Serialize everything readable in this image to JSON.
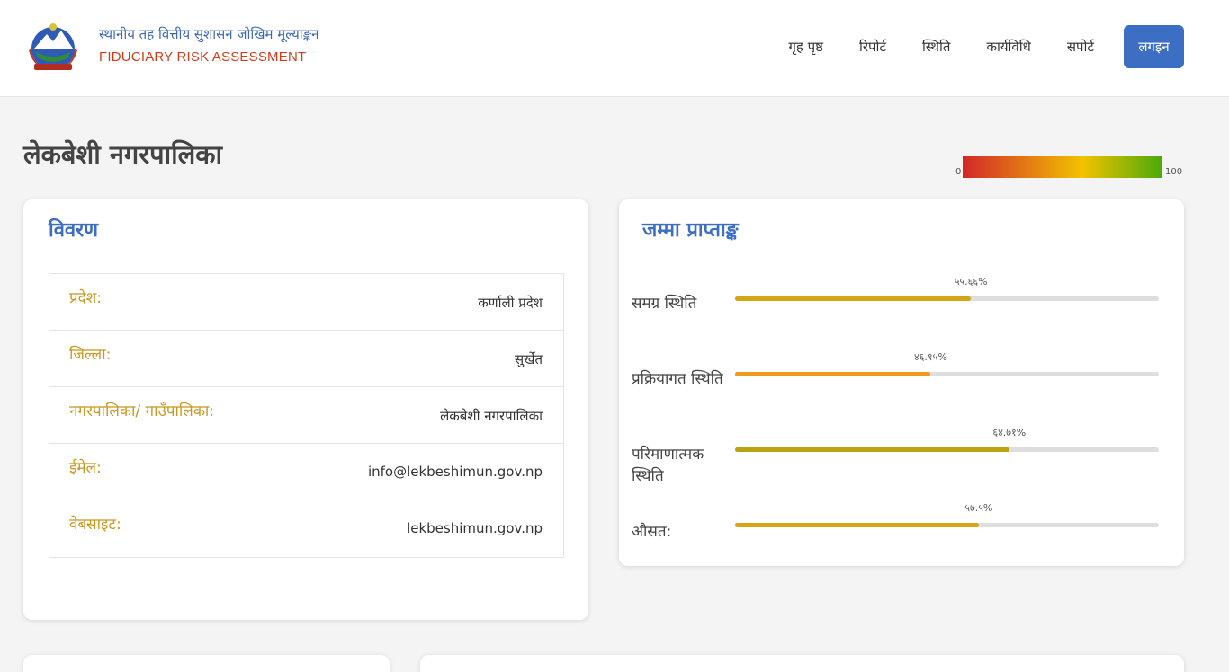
{
  "header": {
    "title_np": "स्थानीय तह वित्तीय सुशासन जोखिम मूल्याङ्कन",
    "title_en": "FIDUCIARY RISK ASSESSMENT",
    "nav": [
      {
        "label": "गृह पृष्ठ",
        "name": "nav-home"
      },
      {
        "label": "रिपोर्ट",
        "name": "nav-report"
      },
      {
        "label": "स्थिति",
        "name": "nav-status"
      },
      {
        "label": "कार्यविधि",
        "name": "nav-procedure"
      },
      {
        "label": "सपोर्ट",
        "name": "nav-support"
      }
    ],
    "login_label": "लगइन"
  },
  "page": {
    "title": "लेकबेशी नगरपालिका"
  },
  "legend": {
    "min": "0",
    "max": "100",
    "colors": [
      "#d32828",
      "#f2c200",
      "#4aaa0a"
    ]
  },
  "details": {
    "title": "विवरण",
    "rows": [
      {
        "label": "प्रदेश:",
        "value": "कर्णाली प्रदेश"
      },
      {
        "label": "जिल्ला:",
        "value": "सुर्खेत"
      },
      {
        "label": "नगरपालिका/ गाउँपालिका:",
        "value": "लेकबेशी नगरपालिका"
      },
      {
        "label": "ईमेल:",
        "value": "info@lekbeshimun.gov.np"
      },
      {
        "label": "वेबसाइट:",
        "value": "lekbeshimun.gov.np"
      }
    ]
  },
  "scores": {
    "title": "जम्मा प्राप्ताङ्क",
    "items": [
      {
        "label": "समग्र स्थिति",
        "pct_text": "५५.६६%",
        "value": 55.66,
        "color": "#d4a514"
      },
      {
        "label": "प्रक्रियागत स्थिति",
        "pct_text": "४६.१५%",
        "value": 46.15,
        "color": "#ef9a1a"
      },
      {
        "label": "परिमाणात्मक स्थिति",
        "pct_text": "६४.७१%",
        "value": 64.71,
        "color": "#b9a312"
      },
      {
        "label": "औसत:",
        "pct_text": "५७.५%",
        "value": 57.5,
        "color": "#d4a514"
      }
    ]
  }
}
